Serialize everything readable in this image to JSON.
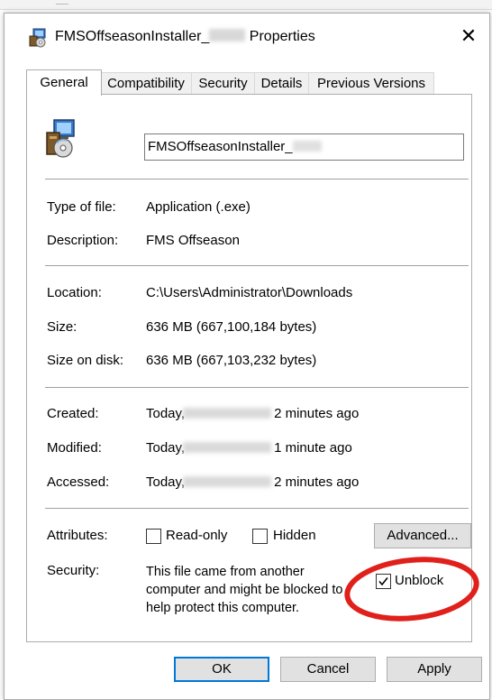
{
  "window": {
    "title_prefix": "FMSOffseasonInstaller_",
    "title_suffix": "Properties",
    "close_glyph": "✕"
  },
  "tabs": [
    {
      "label": "General",
      "active": true
    },
    {
      "label": "Compatibility",
      "active": false
    },
    {
      "label": "Security",
      "active": false
    },
    {
      "label": "Details",
      "active": false
    },
    {
      "label": "Previous Versions",
      "active": false
    }
  ],
  "general": {
    "filename": "FMSOffseasonInstaller_",
    "type_label": "Type of file:",
    "type_value": "Application (.exe)",
    "description_label": "Description:",
    "description_value": "FMS Offseason",
    "location_label": "Location:",
    "location_value": "C:\\Users\\Administrator\\Downloads",
    "size_label": "Size:",
    "size_value": "636 MB (667,100,184 bytes)",
    "size_on_disk_label": "Size on disk:",
    "size_on_disk_value": "636 MB (667,103,232 bytes)",
    "created_label": "Created:",
    "created_prefix": "Today,",
    "created_suffix": "2 minutes ago",
    "modified_label": "Modified:",
    "modified_prefix": "Today,",
    "modified_suffix": "1 minute ago",
    "accessed_label": "Accessed:",
    "accessed_prefix": "Today,",
    "accessed_suffix": "2 minutes ago",
    "attributes_label": "Attributes:",
    "readonly_label": "Read-only",
    "readonly_checked": false,
    "hidden_label": "Hidden",
    "hidden_checked": false,
    "advanced_label": "Advanced...",
    "security_label": "Security:",
    "security_line1": "This file came from another",
    "security_line2": "computer and might be blocked to",
    "security_line3": "help protect this computer.",
    "unblock_label": "Unblock",
    "unblock_checked": true
  },
  "buttons": {
    "ok": "OK",
    "cancel": "Cancel",
    "apply": "Apply"
  },
  "colors": {
    "highlight_ellipse": "#e0201b",
    "default_button_border": "#0078d7"
  }
}
